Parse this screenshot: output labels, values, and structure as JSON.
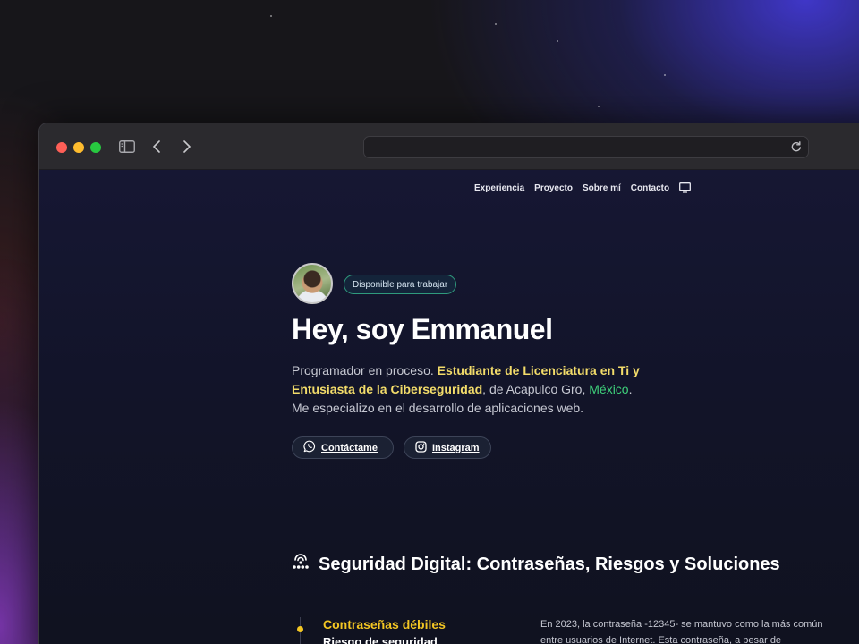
{
  "nav": {
    "items": [
      "Experiencia",
      "Proyecto",
      "Sobre mí",
      "Contacto"
    ],
    "theme_icon": "monitor-icon"
  },
  "hero": {
    "badge": "Disponible para trabajar",
    "title": "Hey, soy Emmanuel",
    "desc_part1": "Programador en proceso. ",
    "desc_highlight": "Estudiante de Licenciatura en Ti y Entusiasta de la Ciberseguridad",
    "desc_part2": ", de Acapulco Gro, ",
    "desc_country": "México",
    "desc_part3": ".",
    "desc_line2": "Me especializo en el desarrollo de aplicaciones web.",
    "contact_label": "Contáctame",
    "instagram_label": "Instagram"
  },
  "section": {
    "title": "Seguridad Digital: Contraseñas, Riesgos y Soluciones",
    "icon": "network-security-icon"
  },
  "timeline": {
    "heading": "Contraseñas débiles",
    "subheading": "Riesgo de seguridad",
    "text": "En 2023, la contraseña -12345- se mantuvo como la más común entre usuarios de Internet. Esta contraseña, a pesar de"
  },
  "colors": {
    "accent_yellow": "#f3dc6a",
    "accent_green": "#3ecf7a",
    "timeline_dot": "#f3c623",
    "badge_border": "#2f9a7d"
  }
}
